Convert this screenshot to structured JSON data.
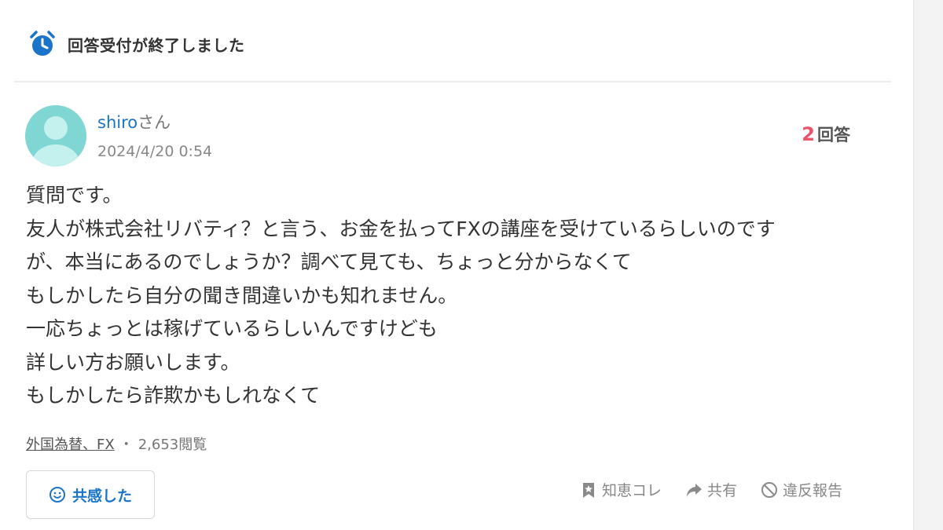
{
  "header": {
    "title": "回答受付が終了しました",
    "icon": "alarm-clock-icon"
  },
  "question": {
    "user": {
      "name": "shiro",
      "suffix": "さん",
      "posted_at": "2024/4/20 0:54"
    },
    "answer_count": "2",
    "answer_label": "回答",
    "body_lines": [
      "質問です。",
      "友人が株式会社リバティ？と言う、お金を払ってFXの講座を受けているらしいのです",
      "が、本当にあるのでしょうか？調べて見ても、ちょっと分からなくて",
      "もしかしたら自分の聞き間違いかも知れません。",
      "一応ちょっとは稼げているらしいんですけども",
      "詳しい方お願いします。",
      "もしかしたら詐欺かもしれなくて"
    ],
    "category": "外国為替、FX",
    "separator": "・",
    "views": "2,653閲覧"
  },
  "actions": {
    "empathy_label": "共感した",
    "chiebukuro_label": "知恵コレ",
    "share_label": "共有",
    "report_label": "違反報告"
  },
  "colors": {
    "accent_blue": "#1a75c8",
    "answer_count_red": "#e9546b",
    "avatar_teal": "#7fd6d2"
  }
}
